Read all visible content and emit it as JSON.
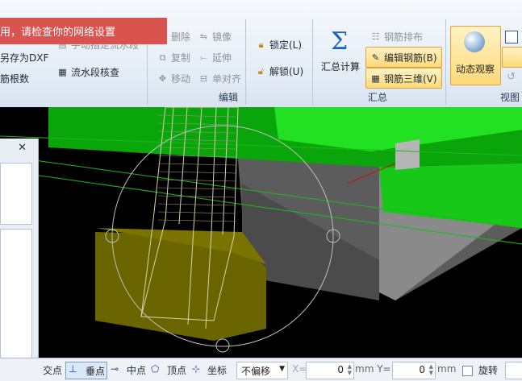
{
  "notification": {
    "text": "用，请检查你的网络设置"
  },
  "ribbon": {
    "left": {
      "save_dxf": "另存为DXF",
      "rebar_count": "筋根数",
      "flow_segment": "手动指定流水段",
      "flow_check": "流水段核查"
    },
    "edit": {
      "delete": "删除",
      "mirror": "镜像",
      "copy": "复制",
      "extend": "延伸",
      "move": "移动",
      "align": "单对齐",
      "label": "编辑"
    },
    "lock": {
      "lock": "锁定(L)",
      "unlock": "解锁(U)"
    },
    "summary": {
      "calc": "汇总计算",
      "rebar_layout": "钢筋排布",
      "edit_rebar": "编辑钢筋(B)",
      "rebar_3d": "钢筋三维(V)",
      "label": "汇总"
    },
    "view": {
      "dynamic_view": "动态观察",
      "label": "视图"
    }
  },
  "statusbar": {
    "intersection": "交点",
    "perpendicular": "垂点",
    "midpoint": "中点",
    "vertex": "顶点",
    "coordinate": "坐标",
    "offset_mode": "不偏移",
    "x_label": "X=",
    "x_value": "0",
    "y_label": "mm Y=",
    "y_value": "0",
    "unit": "mm",
    "rotate": "旋转"
  },
  "colors": {
    "accent_green": "#19d219",
    "notify_red": "#d9534f",
    "block_olive": "#6b6500"
  }
}
